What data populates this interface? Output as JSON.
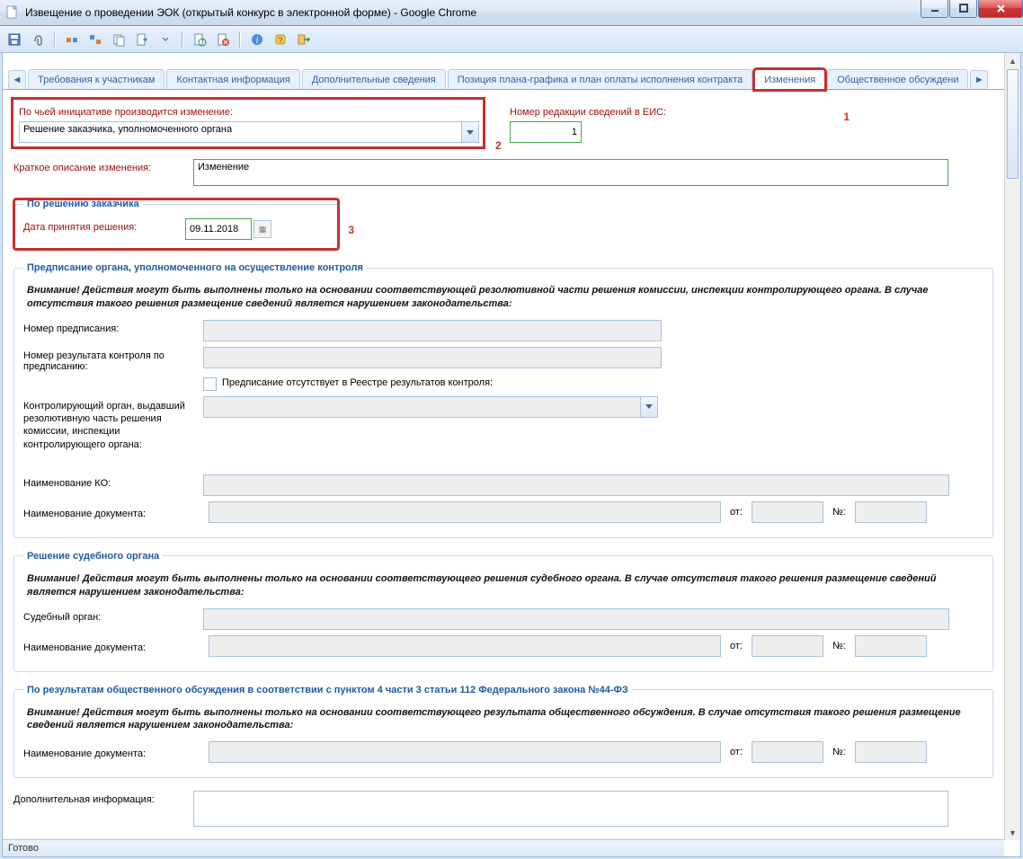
{
  "window": {
    "title": "Извещение о проведении ЭОК (открытый конкурс в электронной форме) - Google Chrome"
  },
  "tabs": {
    "t0": "Требования к участникам",
    "t1": "Контактная информация",
    "t2": "Дополнительные сведения",
    "t3": "Позиция плана-графика и план оплаты исполнения контракта",
    "t4": "Изменения",
    "t5": "Общественное обсуждени"
  },
  "markers": {
    "m1": "1",
    "m2": "2",
    "m3": "3"
  },
  "initiative": {
    "label": "По чьей инициативе производится изменение:",
    "value": "Решение заказчика, уполномоченного органа"
  },
  "revision": {
    "label": "Номер редакции сведений в ЕИС:",
    "value": "1"
  },
  "brief": {
    "label": "Краткое описание изменения:",
    "value": "Изменение"
  },
  "by_customer": {
    "legend": "По решению заказчика",
    "date_label": "Дата принятия решения:",
    "date_value": "09.11.2018"
  },
  "prescript": {
    "legend": "Предписание органа, уполномоченного на осуществление контроля",
    "warn": "Внимание! Действия могут быть выполнены только на основании соответствующей резолютивной части решения комиссии, инспекции контролирующего органа. В случае отсутствия такого решения размещение сведений является нарушением законодательства:",
    "no_label": "Номер предписания:",
    "res_no_label": "Номер результата контроля по предписанию:",
    "absent_label": "Предписание отсутствует в Реестре результатов контроля:",
    "body_label": "Контролирующий орган, выдавший резолютивную часть решения комиссии, инспекции контролирующего органа:",
    "ko_name_label": "Наименование КО:",
    "doc_name_label": "Наименование документа:",
    "from_label": "от:",
    "num_label": "№:"
  },
  "court": {
    "legend": "Решение судебного органа",
    "warn": "Внимание! Действия могут быть выполнены только на основании соответствующего решения судебного органа. В случае отсутствия такого решения размещение сведений является нарушением законодательства:",
    "body_label": "Судебный орган:",
    "doc_name_label": "Наименование документа:",
    "from_label": "от:",
    "num_label": "№:"
  },
  "public": {
    "legend": "По результатам общественного обсуждения в соответствии с пунктом 4 части 3 статьи 112 Федерального закона №44-ФЗ",
    "warn": "Внимание! Действия могут быть выполнены только на основании соответствующего результата общественного обсуждения. В случае отсутствия такого решения размещение сведений является нарушением законодательства:",
    "doc_name_label": "Наименование документа:",
    "from_label": "от:",
    "num_label": "№:"
  },
  "addinfo": {
    "label": "Дополнительная информация:"
  },
  "status": "Готово"
}
